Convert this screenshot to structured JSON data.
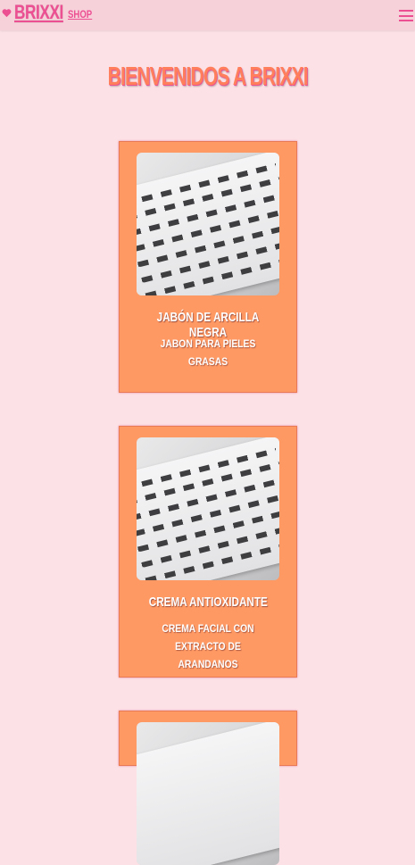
{
  "header": {
    "brand_name": "BRIXXI",
    "shop_label": "SHOP",
    "icons": {
      "brand": "heart-icon",
      "menu": "menu-icon"
    },
    "colors": {
      "accent": "#ec4f92",
      "bar": "#f7d1da"
    }
  },
  "main": {
    "title": "BIENVENIDOS A BRIXXI",
    "products": [
      {
        "name": "JABÓN DE ARCILLA NEGRA",
        "description": "JABON PARA PIELES GRASAS"
      },
      {
        "name": "CREMA ANTIOXIDANTE",
        "description": "CREMA FACIAL CON EXTRACTO DE ARANDANOS"
      }
    ],
    "colors": {
      "card": "#ff9963",
      "title": "#ff7f5c",
      "background": "#fce1e6"
    }
  }
}
